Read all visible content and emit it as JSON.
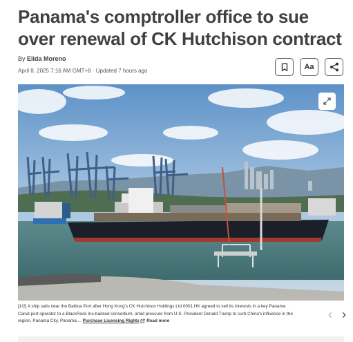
{
  "article": {
    "headline": "Panama's comptroller office to sue over renewal of CK Hutchison contract",
    "byline_prefix": "By ",
    "author": "Elida Moreno",
    "dateline": "April 8, 2025 7:16 AM GMT+8 · Updated 7 hours ago"
  },
  "actions": {
    "bookmark_icon": "bookmark-icon",
    "text_size_label": "Aa",
    "share_icon": "share-icon"
  },
  "photo": {
    "expand_icon": "expand-icon"
  },
  "caption": {
    "text": "[1/2] A ship sails near the Balboa Port after Hong Kong's CK Hutchison Holdings Ltd 0001.HK agreed to sell its interests in a key Panama Canal port operator to a BlackRock Inc-backed consortium, amid pressure from U.S. President Donald Trump to curb China's influence in the region, Panama City, Panama,... ",
    "license_link": "Purchase Licensing Rights",
    "read_more": "Read more"
  },
  "carousel": {
    "prev": "‹",
    "next": "›"
  }
}
